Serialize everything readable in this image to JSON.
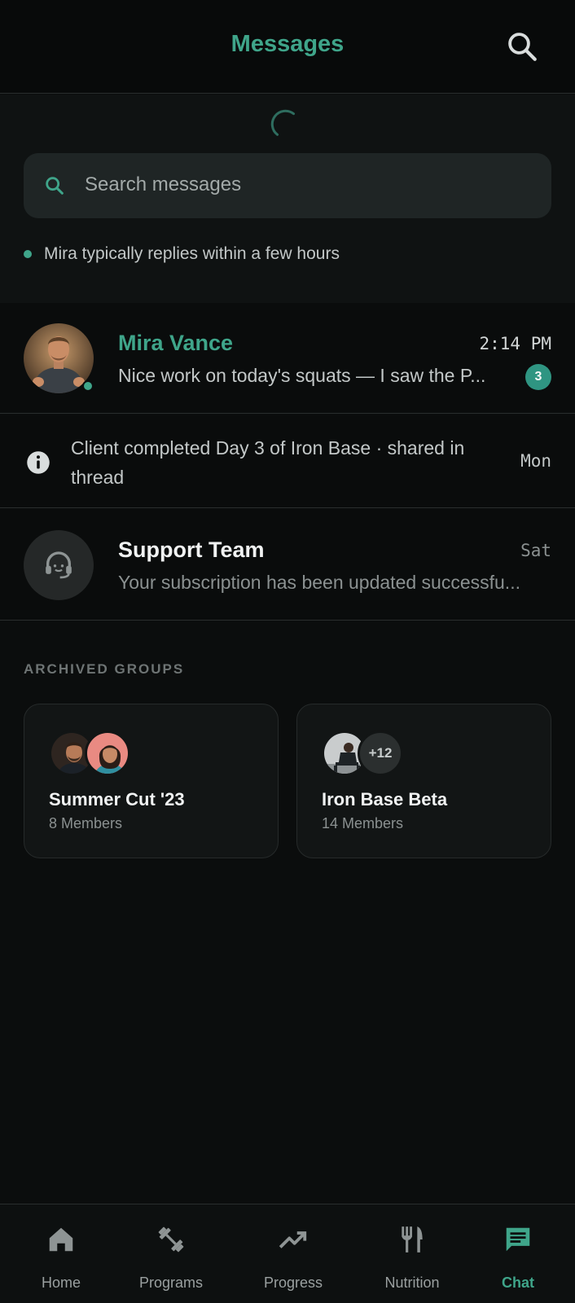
{
  "header": {
    "title": "Messages",
    "search_icon": "search-icon"
  },
  "search": {
    "placeholder": "Search messages"
  },
  "reply_note": "Mira typically replies within a few hours",
  "conversations": [
    {
      "name": "Mira Vance",
      "time": "2:14 PM",
      "preview": "Nice work on today's squats — I saw the P...",
      "unread": "3",
      "online": true
    },
    {
      "name": "Support Team",
      "time": "Sat",
      "preview": "Your subscription has been updated successfu..."
    }
  ],
  "system_notice": {
    "text": "Client completed Day 3 of Iron Base · shared in thread",
    "time": "Mon"
  },
  "archived": {
    "label": "ARCHIVED GROUPS",
    "groups": [
      {
        "name": "Summer Cut '23",
        "members": "8 Members"
      },
      {
        "name": "Iron Base Beta",
        "members": "14 Members",
        "extra": "+12"
      }
    ]
  },
  "tabs": [
    {
      "label": "Home",
      "icon": "home-icon"
    },
    {
      "label": "Programs",
      "icon": "dumbbell-icon"
    },
    {
      "label": "Progress",
      "icon": "trending-up-icon"
    },
    {
      "label": "Nutrition",
      "icon": "fork-knife-icon"
    },
    {
      "label": "Chat",
      "icon": "chat-icon",
      "active": true
    }
  ],
  "colors": {
    "accent": "#3fa58a",
    "background": "#0b0d0d",
    "badge": "#2f9582"
  }
}
